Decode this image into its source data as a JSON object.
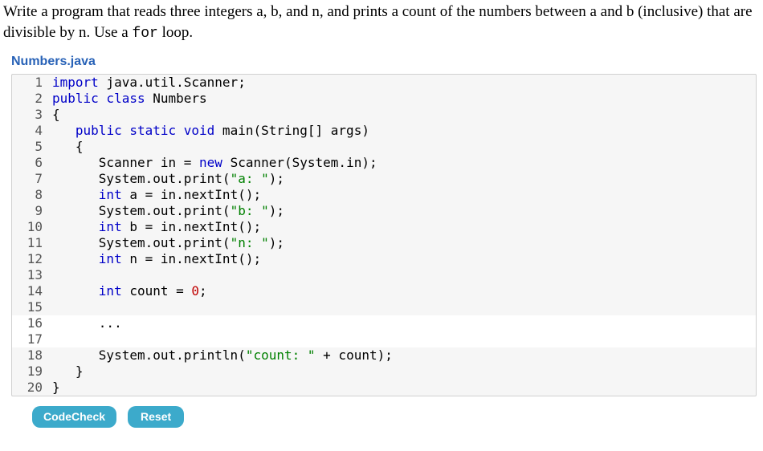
{
  "problem": {
    "text_before_code": "Write a program that reads three integers a, b, and n, and prints a count of the numbers between a and b (inclusive) that are divisible by n. Use a ",
    "code_word": "for",
    "text_after_code": " loop."
  },
  "filename": "Numbers.java",
  "code": {
    "lines": [
      {
        "n": "1",
        "editable": false,
        "tokens": [
          [
            "kw",
            "import"
          ],
          [
            "",
            " java.util.Scanner;"
          ]
        ]
      },
      {
        "n": "2",
        "editable": false,
        "tokens": [
          [
            "kw",
            "public class"
          ],
          [
            "",
            " "
          ],
          [
            "cls",
            "Numbers"
          ]
        ]
      },
      {
        "n": "3",
        "editable": false,
        "tokens": [
          [
            "",
            "{"
          ]
        ]
      },
      {
        "n": "4",
        "editable": false,
        "tokens": [
          [
            "",
            "   "
          ],
          [
            "kw",
            "public static void"
          ],
          [
            "",
            " main(String[] args)"
          ]
        ]
      },
      {
        "n": "5",
        "editable": false,
        "tokens": [
          [
            "",
            "   {"
          ]
        ]
      },
      {
        "n": "6",
        "editable": false,
        "tokens": [
          [
            "",
            "      Scanner in = "
          ],
          [
            "kw",
            "new"
          ],
          [
            "",
            " Scanner(System.in);"
          ]
        ]
      },
      {
        "n": "7",
        "editable": false,
        "tokens": [
          [
            "",
            "      System.out.print("
          ],
          [
            "str",
            "\"a: \""
          ],
          [
            "",
            ");"
          ]
        ]
      },
      {
        "n": "8",
        "editable": false,
        "tokens": [
          [
            "",
            "      "
          ],
          [
            "kw",
            "int"
          ],
          [
            "",
            " a = in.nextInt();"
          ]
        ]
      },
      {
        "n": "9",
        "editable": false,
        "tokens": [
          [
            "",
            "      System.out.print("
          ],
          [
            "str",
            "\"b: \""
          ],
          [
            "",
            ");"
          ]
        ]
      },
      {
        "n": "10",
        "editable": false,
        "tokens": [
          [
            "",
            "      "
          ],
          [
            "kw",
            "int"
          ],
          [
            "",
            " b = in.nextInt();"
          ]
        ]
      },
      {
        "n": "11",
        "editable": false,
        "tokens": [
          [
            "",
            "      System.out.print("
          ],
          [
            "str",
            "\"n: \""
          ],
          [
            "",
            ");"
          ]
        ]
      },
      {
        "n": "12",
        "editable": false,
        "tokens": [
          [
            "",
            "      "
          ],
          [
            "kw",
            "int"
          ],
          [
            "",
            " n = in.nextInt();"
          ]
        ]
      },
      {
        "n": "13",
        "editable": false,
        "tokens": [
          [
            "",
            ""
          ]
        ]
      },
      {
        "n": "14",
        "editable": false,
        "tokens": [
          [
            "",
            "      "
          ],
          [
            "kw",
            "int"
          ],
          [
            "",
            " count = "
          ],
          [
            "num",
            "0"
          ],
          [
            "",
            ";"
          ]
        ]
      },
      {
        "n": "15",
        "editable": false,
        "tokens": [
          [
            "",
            ""
          ]
        ]
      },
      {
        "n": "16",
        "editable": true,
        "tokens": [
          [
            "",
            "      ..."
          ]
        ]
      },
      {
        "n": "17",
        "editable": true,
        "tokens": [
          [
            "",
            ""
          ]
        ]
      },
      {
        "n": "18",
        "editable": false,
        "tokens": [
          [
            "",
            "      System.out.println("
          ],
          [
            "str",
            "\"count: \""
          ],
          [
            "",
            " + count);"
          ]
        ]
      },
      {
        "n": "19",
        "editable": false,
        "tokens": [
          [
            "",
            "   }"
          ]
        ]
      },
      {
        "n": "20",
        "editable": false,
        "tokens": [
          [
            "",
            "}"
          ]
        ]
      }
    ]
  },
  "buttons": {
    "codecheck": "CodeCheck",
    "reset": "Reset"
  }
}
